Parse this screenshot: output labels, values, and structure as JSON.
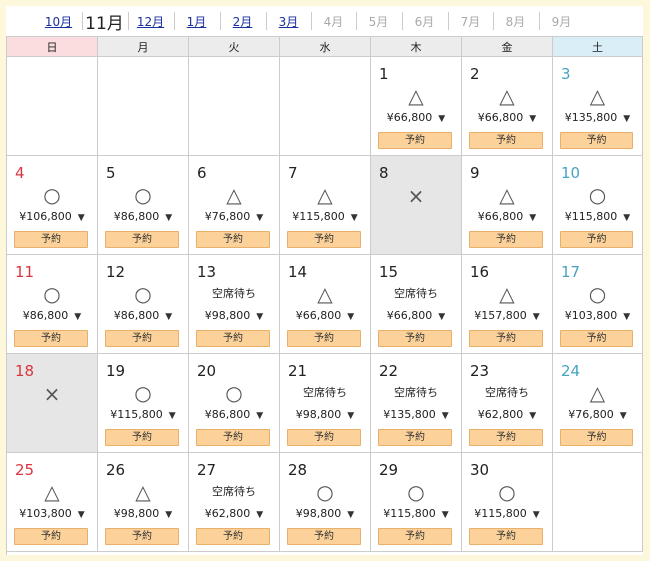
{
  "month_tabs": [
    {
      "label": "10月",
      "state": "link"
    },
    {
      "label": "11月",
      "state": "current"
    },
    {
      "label": "12月",
      "state": "link"
    },
    {
      "label": "1月",
      "state": "link"
    },
    {
      "label": "2月",
      "state": "link"
    },
    {
      "label": "3月",
      "state": "link"
    },
    {
      "label": "4月",
      "state": "disabled"
    },
    {
      "label": "5月",
      "state": "disabled"
    },
    {
      "label": "6月",
      "state": "disabled"
    },
    {
      "label": "7月",
      "state": "disabled"
    },
    {
      "label": "8月",
      "state": "disabled"
    },
    {
      "label": "9月",
      "state": "disabled"
    }
  ],
  "weekdays": [
    "日",
    "月",
    "火",
    "水",
    "木",
    "金",
    "土"
  ],
  "book_label": "予約",
  "arrow_icon": "▼",
  "colors": {
    "sunday": "#d8363f",
    "saturday": "#46a3c2",
    "book_button": "#fcd29a",
    "closed": "#e6e6e6"
  },
  "days": [
    {
      "d": "1",
      "sym": "△",
      "price": "¥66,800"
    },
    {
      "d": "2",
      "sym": "△",
      "price": "¥66,800"
    },
    {
      "d": "3",
      "sym": "△",
      "price": "¥135,800"
    },
    {
      "d": "4",
      "sym": "○",
      "price": "¥106,800"
    },
    {
      "d": "5",
      "sym": "○",
      "price": "¥86,800"
    },
    {
      "d": "6",
      "sym": "△",
      "price": "¥76,800"
    },
    {
      "d": "7",
      "sym": "△",
      "price": "¥115,800"
    },
    {
      "d": "8",
      "sym": "×",
      "closed": true
    },
    {
      "d": "9",
      "sym": "△",
      "price": "¥66,800"
    },
    {
      "d": "10",
      "sym": "○",
      "price": "¥115,800"
    },
    {
      "d": "11",
      "sym": "○",
      "price": "¥86,800"
    },
    {
      "d": "12",
      "sym": "○",
      "price": "¥86,800"
    },
    {
      "d": "13",
      "sym": "空席待ち",
      "price": "¥98,800"
    },
    {
      "d": "14",
      "sym": "△",
      "price": "¥66,800"
    },
    {
      "d": "15",
      "sym": "空席待ち",
      "price": "¥66,800"
    },
    {
      "d": "16",
      "sym": "△",
      "price": "¥157,800"
    },
    {
      "d": "17",
      "sym": "○",
      "price": "¥103,800"
    },
    {
      "d": "18",
      "sym": "×",
      "closed": true
    },
    {
      "d": "19",
      "sym": "○",
      "price": "¥115,800"
    },
    {
      "d": "20",
      "sym": "○",
      "price": "¥86,800"
    },
    {
      "d": "21",
      "sym": "空席待ち",
      "price": "¥98,800"
    },
    {
      "d": "22",
      "sym": "空席待ち",
      "price": "¥135,800"
    },
    {
      "d": "23",
      "sym": "空席待ち",
      "price": "¥62,800"
    },
    {
      "d": "24",
      "sym": "△",
      "price": "¥76,800"
    },
    {
      "d": "25",
      "sym": "△",
      "price": "¥103,800"
    },
    {
      "d": "26",
      "sym": "△",
      "price": "¥98,800"
    },
    {
      "d": "27",
      "sym": "空席待ち",
      "price": "¥62,800"
    },
    {
      "d": "28",
      "sym": "○",
      "price": "¥98,800"
    },
    {
      "d": "29",
      "sym": "○",
      "price": "¥115,800"
    },
    {
      "d": "30",
      "sym": "○",
      "price": "¥115,800"
    }
  ],
  "first_weekday_index": 4
}
